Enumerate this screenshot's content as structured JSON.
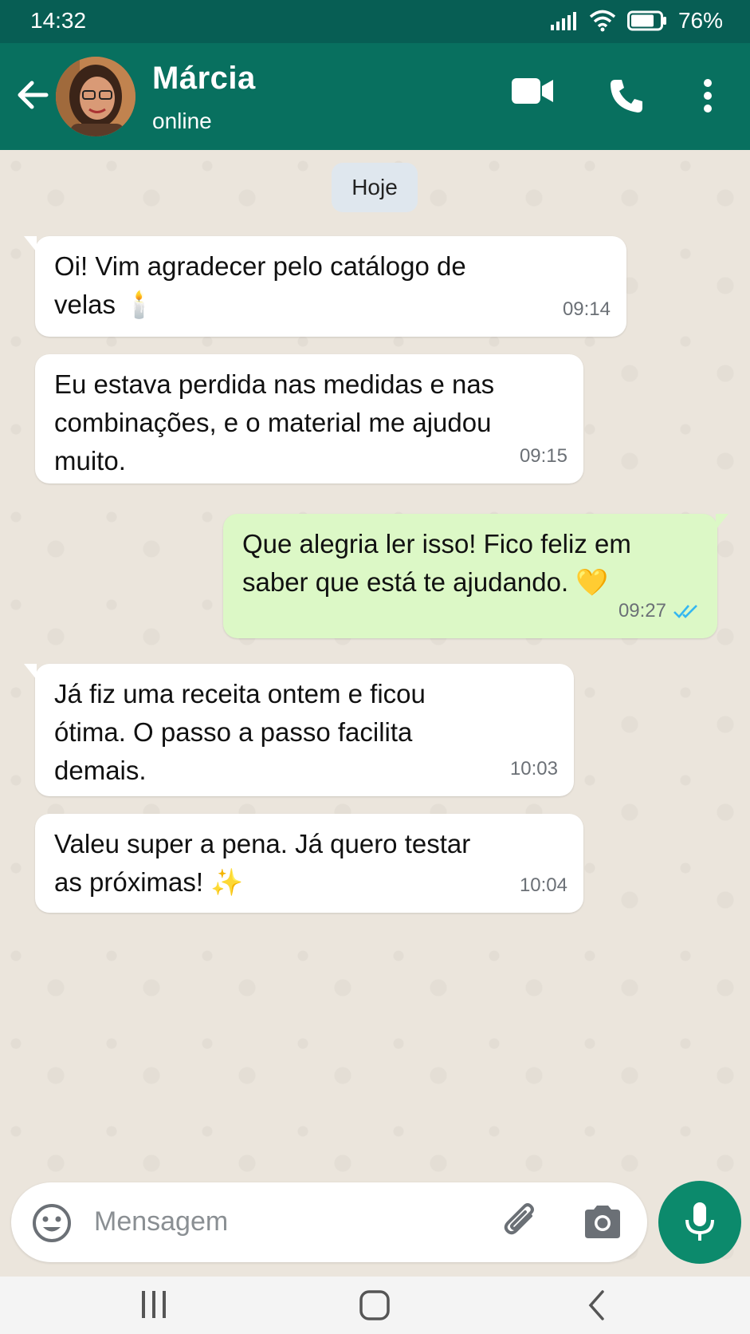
{
  "status_bar": {
    "time": "14:32",
    "battery": "76%"
  },
  "header": {
    "contact_name": "Márcia",
    "contact_status": "online"
  },
  "chat": {
    "day_label": "Hoje",
    "messages": [
      {
        "direction": "in",
        "lines": [
          "Oi! Vim agradecer pelo catálogo de",
          "velas 🕯️"
        ],
        "time": "09:14"
      },
      {
        "direction": "in",
        "lines": [
          "Eu estava perdida nas medidas e nas",
          "combinações, e o material me ajudou",
          "muito."
        ],
        "time": "09:15"
      },
      {
        "direction": "out",
        "lines": [
          "Que alegria ler isso! Fico feliz em",
          "saber que está te ajudando. 💛"
        ],
        "time": "09:27",
        "status": "read"
      },
      {
        "direction": "in",
        "lines": [
          "Já fiz uma receita ontem e ficou",
          "ótima. O passo a passo facilita",
          "demais."
        ],
        "time": "10:03"
      },
      {
        "direction": "in",
        "lines": [
          "Valeu super a pena. Já quero testar",
          "as próximas! ✨"
        ],
        "time": "10:04"
      }
    ]
  },
  "composer": {
    "placeholder": "Mensagem"
  },
  "colors": {
    "header": "#08705f",
    "status_bar": "#075e54",
    "outgoing_bubble": "#dcf8c6",
    "mic_button": "#0c8a6c",
    "read_ticks": "#34b7f1"
  },
  "icons": [
    "back-arrow-icon",
    "video-call-icon",
    "phone-icon",
    "more-options-icon",
    "emoji-icon",
    "attach-icon",
    "camera-icon",
    "mic-icon"
  ]
}
